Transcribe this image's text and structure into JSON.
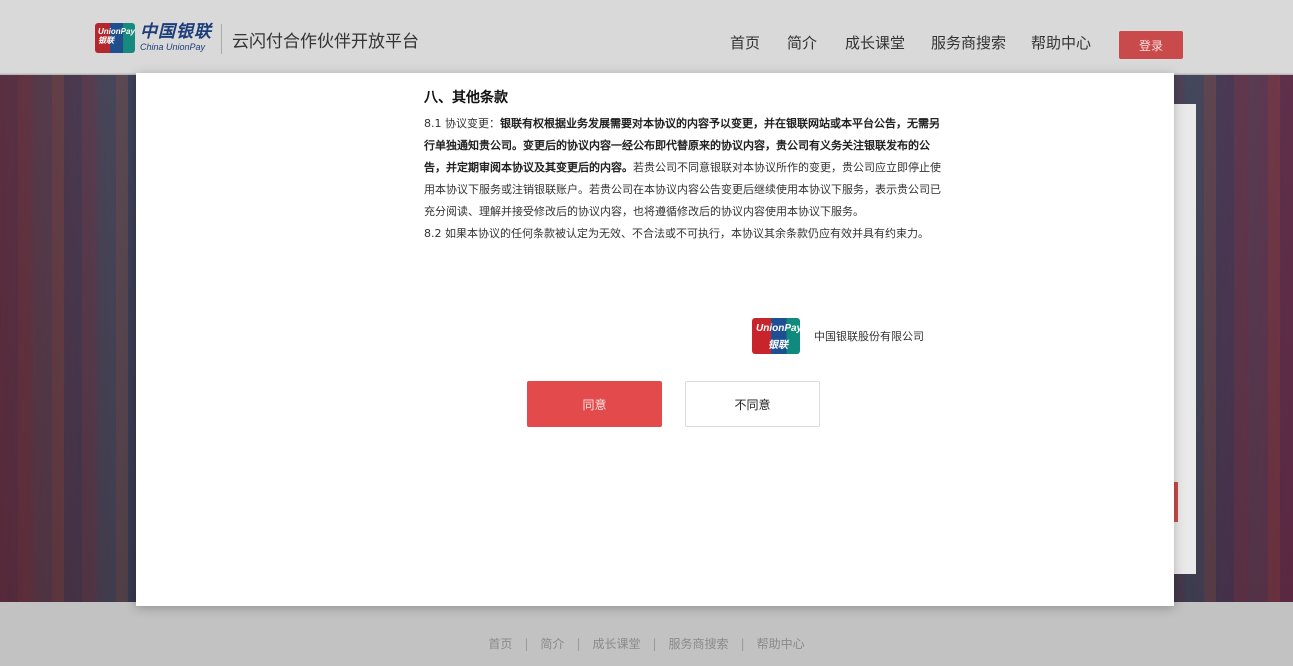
{
  "header": {
    "logo_badge": "UnionPay 银联",
    "logo_cn": "中国银联",
    "logo_en": "China UnionPay",
    "platform_title": "云闪付合作伙伴开放平台",
    "nav": [
      "首页",
      "简介",
      "成长课堂",
      "服务商搜索",
      "帮助中心"
    ],
    "login_label": "登录"
  },
  "modal": {
    "section_title": "八、其他条款",
    "p1_prefix": "8.1 协议变更：",
    "p1_bold": "银联有权根据业务发展需要对本协议的内容予以变更，并在银联网站或本平台公告，无需另行单独通知贵公司。变更后的协议内容一经公布即代替原来的协议内容，贵公司有义务关注银联发布的公告，并定期审阅本协议及其变更后的内容。",
    "p1_rest": "若贵公司不同意银联对本协议所作的变更，贵公司应立即停止使用本协议下服务或注销银联账户。若贵公司在本协议内容公告变更后继续使用本协议下服务，表示贵公司已充分阅读、理解并接受修改后的协议内容，也将遵循修改后的协议内容使用本协议下服务。",
    "p2": "8.2 如果本协议的任何条款被认定为无效、不合法或不可执行，本协议其余条款仍应有效并具有约束力。",
    "sign_logo_top": "UnionPay",
    "sign_logo_bottom": "银联",
    "company": "中国银联股份有限公司",
    "agree_label": "同意",
    "disagree_label": "不同意"
  },
  "footer": {
    "links": [
      "首页",
      "简介",
      "成长课堂",
      "服务商搜索",
      "帮助中心"
    ],
    "separator": "|"
  },
  "colors": {
    "brand_red": "#e34a4c",
    "login_red": "#c94a4a",
    "brand_blue": "#1d3d7a"
  },
  "icons": [
    "unionpay-logo-icon"
  ]
}
